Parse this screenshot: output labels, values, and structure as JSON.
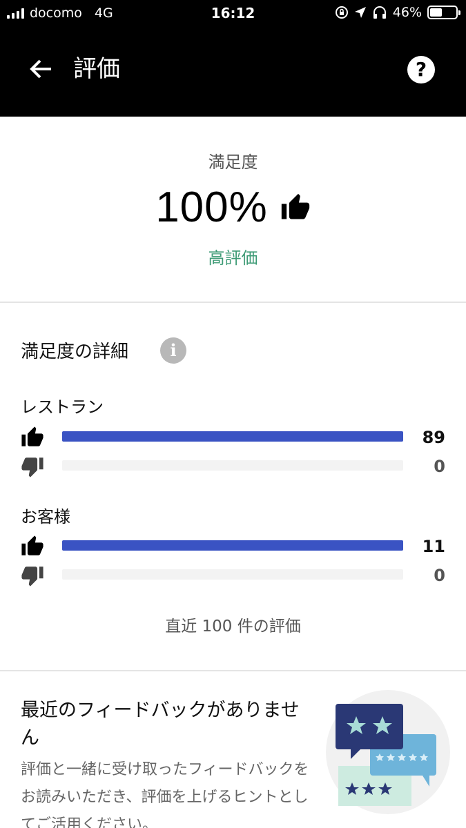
{
  "status_bar": {
    "carrier": "docomo",
    "network": "4G",
    "time": "16:12",
    "battery_text": "46%",
    "battery_level": 0.46
  },
  "header": {
    "title": "評価",
    "back_icon": "arrow-left-icon",
    "help_label": "?"
  },
  "summary": {
    "label": "満足度",
    "value": "100%",
    "status": "高評価",
    "status_color": "#3e9b76"
  },
  "details": {
    "title": "満足度の詳細",
    "info_label": "i",
    "bar_color": "#3a53c3",
    "groups": [
      {
        "label": "レストラン",
        "thumbs_up": "89",
        "thumbs_down": "0",
        "up_fraction": 1.0,
        "down_fraction": 0.0
      },
      {
        "label": "お客様",
        "thumbs_up": "11",
        "thumbs_down": "0",
        "up_fraction": 1.0,
        "down_fraction": 0.0
      }
    ],
    "footnote": "直近 100 件の評価"
  },
  "feedback": {
    "title": "最近のフィードバックがありません",
    "body": "評価と一緒に受け取ったフィードバックをお読みいただき、評価を上げるヒントとしてご活用ください。"
  }
}
